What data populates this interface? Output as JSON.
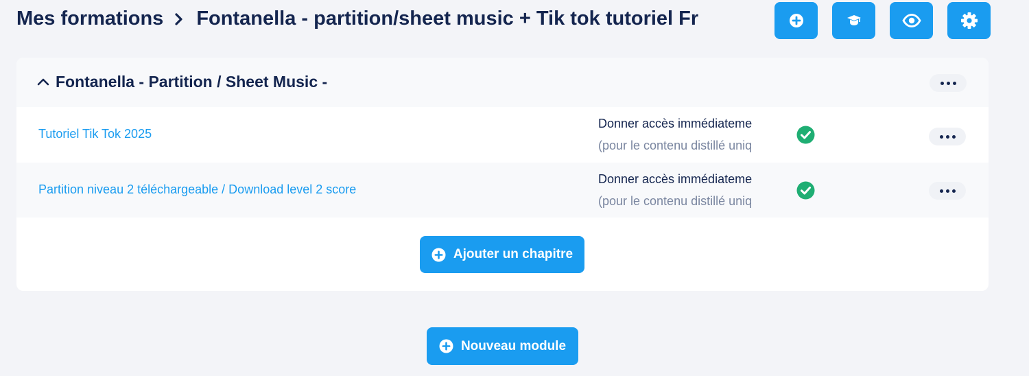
{
  "breadcrumb": {
    "root": "Mes formations",
    "current": "Fontanella - partition/sheet music + Tik tok tutoriel Fr"
  },
  "toolbar": {
    "buttons": [
      {
        "icon": "plus-circle-icon"
      },
      {
        "icon": "graduation-cap-icon"
      },
      {
        "icon": "eye-icon"
      },
      {
        "icon": "gear-icon"
      }
    ]
  },
  "module": {
    "title": "Fontanella - Partition / Sheet Music -",
    "chapters": [
      {
        "title": "Tutoriel Tik Tok 2025",
        "access_label": "Donner accès immédiateme",
        "access_note": "(pour le contenu distillé uniq",
        "status_icon": "check-circle-icon"
      },
      {
        "title": "Partition niveau 2 téléchargeable / Download level 2 score",
        "access_label": "Donner accès immédiateme",
        "access_note": "(pour le contenu distillé uniq",
        "status_icon": "check-circle-icon"
      }
    ],
    "add_chapter_label": "Ajouter un chapitre"
  },
  "new_module_label": "Nouveau module",
  "colors": {
    "accent": "#1a9cf0",
    "text_dark": "#14254f",
    "success": "#1fae73",
    "background": "#f3f4f8"
  }
}
